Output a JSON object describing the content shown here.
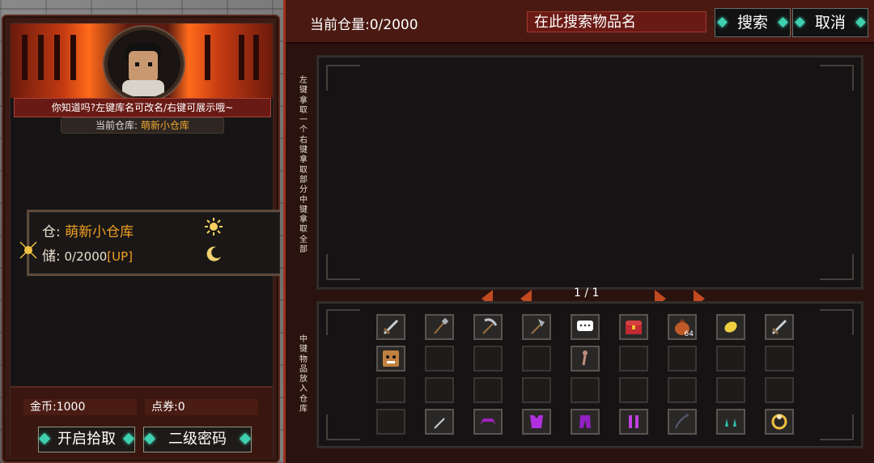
{
  "left": {
    "tip": "你知道吗?左键库名可改名/右键可展示哦~",
    "current_label": "当前仓库:",
    "current_value": "萌新小仓库",
    "store": {
      "name_label": "仓:",
      "name_value": "萌新小仓库",
      "cap_label": "储:",
      "cap_value": "0/2000",
      "up": "[UP]"
    },
    "gold_label": "金币:",
    "gold_value": "1000",
    "points_label": "点券:",
    "points_value": "0",
    "btn_pickup": "开启拾取",
    "btn_password": "二级密码"
  },
  "right": {
    "capacity": "当前仓量:0/2000",
    "search_placeholder": "在此搜索物品名",
    "btn_search": "搜索",
    "btn_cancel": "取消",
    "hint_top": "左键拿取一个 右键拿取部分 中键拿取全部",
    "hint_bottom": "中键物品放入仓库",
    "page": "1 / 1"
  },
  "inventory": [
    {
      "icon": "sword-icon"
    },
    {
      "icon": "shovel-icon"
    },
    {
      "icon": "pickaxe-icon"
    },
    {
      "icon": "axe-icon"
    },
    {
      "icon": "speech-bubble-icon"
    },
    {
      "icon": "treasure-chest-icon"
    },
    {
      "icon": "bag-icon",
      "count": "64"
    },
    {
      "icon": "gold-coin-icon"
    },
    {
      "icon": "sword-icon"
    },
    {
      "icon": "monster-face-icon"
    },
    {
      "icon": ""
    },
    {
      "icon": ""
    },
    {
      "icon": ""
    },
    {
      "icon": "figure-icon"
    },
    {
      "icon": ""
    },
    {
      "icon": ""
    },
    {
      "icon": ""
    },
    {
      "icon": ""
    },
    {
      "icon": ""
    },
    {
      "icon": ""
    },
    {
      "icon": ""
    },
    {
      "icon": ""
    },
    {
      "icon": ""
    },
    {
      "icon": ""
    },
    {
      "icon": ""
    },
    {
      "icon": ""
    },
    {
      "icon": ""
    },
    {
      "icon": ""
    },
    {
      "icon": "dagger-icon"
    },
    {
      "icon": "purple-helmet-icon"
    },
    {
      "icon": "purple-armor-icon"
    },
    {
      "icon": "purple-pants-icon"
    },
    {
      "icon": "purple-boots-icon"
    },
    {
      "icon": "whip-icon"
    },
    {
      "icon": "teal-earrings-icon"
    },
    {
      "icon": "gold-ring-icon"
    }
  ]
}
